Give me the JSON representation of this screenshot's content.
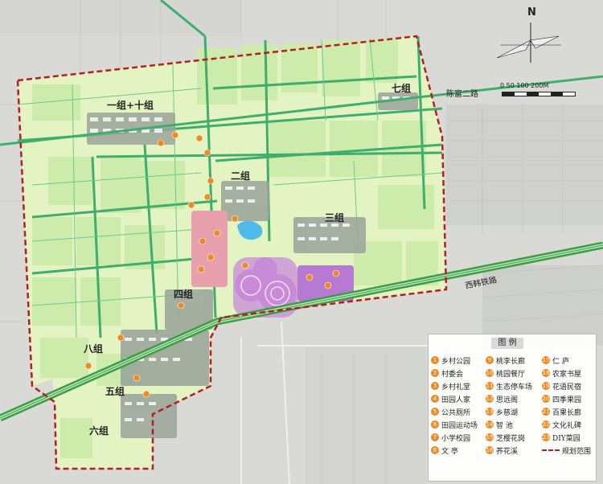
{
  "map": {
    "groups": [
      "一组+十组",
      "二组",
      "三组",
      "四组",
      "五组",
      "六组",
      "七组",
      "八组"
    ],
    "roads": [
      "陈富二路",
      "西韩铁路"
    ],
    "north_label": "N",
    "scale_label": "0  50  100    200M",
    "legend": {
      "title": "图 例",
      "items": [
        {
          "num": "1",
          "label": "乡村公园"
        },
        {
          "num": "9",
          "label": "桃李长廊"
        },
        {
          "num": "17",
          "label": "仁 庐"
        },
        {
          "num": "2",
          "label": "村委会"
        },
        {
          "num": "10",
          "label": "桃园餐厅"
        },
        {
          "num": "18",
          "label": "农家书屋"
        },
        {
          "num": "3",
          "label": "乡村礼堂"
        },
        {
          "num": "11",
          "label": "生态停车场"
        },
        {
          "num": "19",
          "label": "花语民宿"
        },
        {
          "num": "4",
          "label": "田园人家"
        },
        {
          "num": "12",
          "label": "思远阁"
        },
        {
          "num": "20",
          "label": "四季果园"
        },
        {
          "num": "5",
          "label": "公共厕所"
        },
        {
          "num": "13",
          "label": "乡慈湖"
        },
        {
          "num": "21",
          "label": "百果长廊"
        },
        {
          "num": "6",
          "label": "田园运动场"
        },
        {
          "num": "14",
          "label": "智 池"
        },
        {
          "num": "22",
          "label": "文化礼碑"
        },
        {
          "num": "7",
          "label": "小学校园"
        },
        {
          "num": "15",
          "label": "芝樱花岗"
        },
        {
          "num": "23",
          "label": "DIY菜园"
        },
        {
          "num": "8",
          "label": "文 亭"
        },
        {
          "num": "16",
          "label": "荞花溪"
        },
        {
          "num": "",
          "label": "规划范围"
        }
      ]
    },
    "colors": {
      "field_light": "#e3f3c2",
      "field_mid": "#cdebab",
      "road_green": "#3fae6c",
      "boundary": "#b21f24",
      "rail": "#3b9e48",
      "marker": "#ec8a23",
      "flowers": "#c78bd8",
      "pink_zone": "#e8a0ad",
      "lake": "#4fb9e8"
    }
  }
}
